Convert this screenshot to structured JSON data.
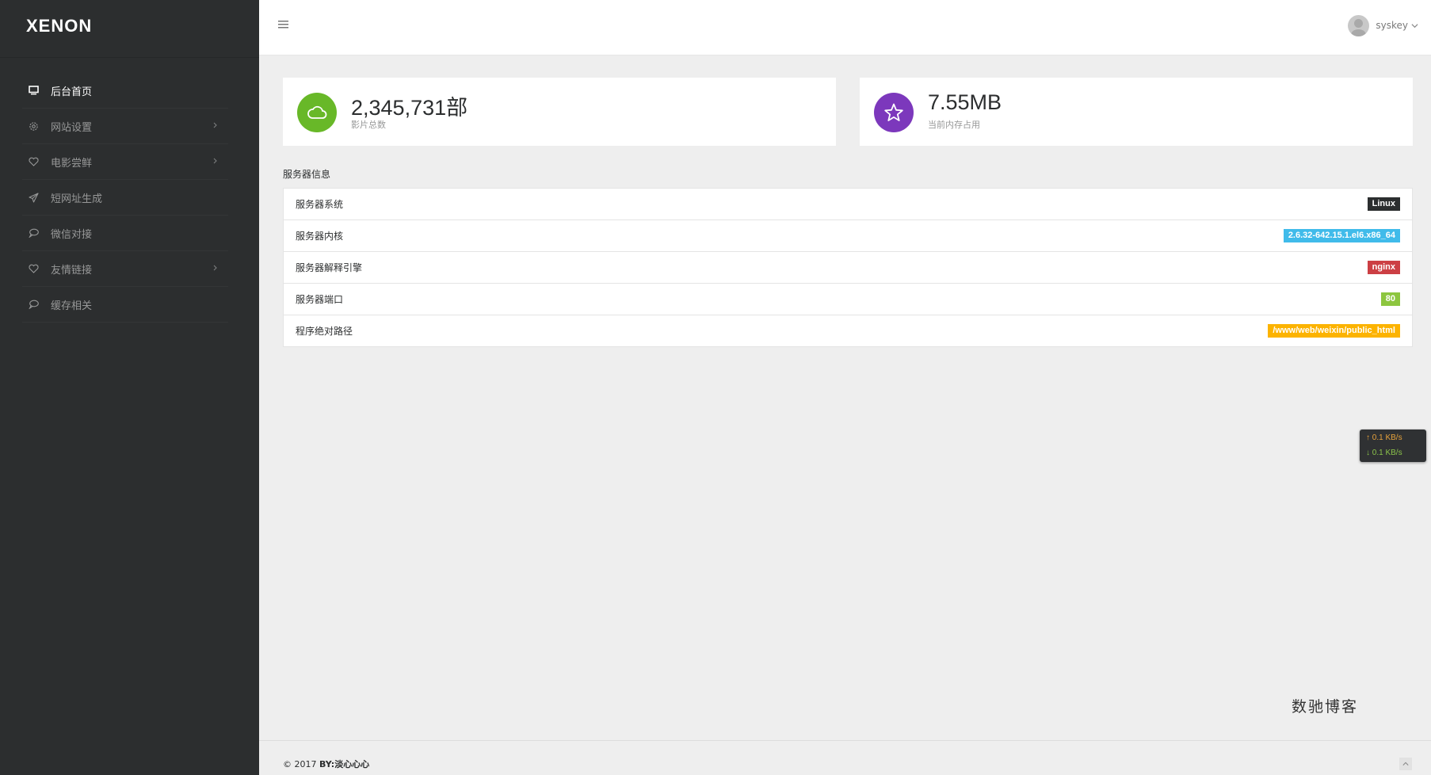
{
  "brand": {
    "logo_text": "XENON"
  },
  "sidebar": {
    "items": [
      {
        "label": "后台首页",
        "icon": "monitor-icon",
        "active": true,
        "has_arrow": false
      },
      {
        "label": "网站设置",
        "icon": "gear-icon",
        "active": false,
        "has_arrow": true
      },
      {
        "label": "电影尝鲜",
        "icon": "heart-icon",
        "active": false,
        "has_arrow": true
      },
      {
        "label": "短网址生成",
        "icon": "send-icon",
        "active": false,
        "has_arrow": false
      },
      {
        "label": "微信对接",
        "icon": "chat-bubble-icon",
        "active": false,
        "has_arrow": false
      },
      {
        "label": "友情链接",
        "icon": "heart-icon",
        "active": false,
        "has_arrow": true
      },
      {
        "label": "缓存相关",
        "icon": "chat-bubble-icon",
        "active": false,
        "has_arrow": false
      }
    ]
  },
  "header": {
    "username": "syskey"
  },
  "stats": [
    {
      "value": "2,345,731部",
      "label": "影片总数",
      "icon": "cloud-icon",
      "color": "#68b828"
    },
    {
      "value": "7.55MB",
      "label": "当前内存占用",
      "icon": "star-icon",
      "color": "#7c38bc"
    }
  ],
  "server_info": {
    "title": "服务器信息",
    "rows": [
      {
        "label": "服务器系统",
        "value": "Linux",
        "color": "#2c2e2f"
      },
      {
        "label": "服务器内核",
        "value": "2.6.32-642.15.1.el6.x86_64",
        "color": "#40bbea"
      },
      {
        "label": "服务器解释引擎",
        "value": "nginx",
        "color": "#cc3f44"
      },
      {
        "label": "服务器端口",
        "value": "80",
        "color": "#8dc63f"
      },
      {
        "label": "程序绝对路径",
        "value": "/www/web/weixin/public_html",
        "color": "#fcb300"
      }
    ]
  },
  "netspeed": {
    "up": "↑ 0.1 KB/s",
    "down": "↓ 0.1 KB/s"
  },
  "watermark": "数驰博客",
  "footer": {
    "copyright": "© 2017 ",
    "author": "BY:淡心心心"
  },
  "colors": {
    "sidebar_bg": "#2c2e2f",
    "page_bg": "#eeeeee"
  }
}
